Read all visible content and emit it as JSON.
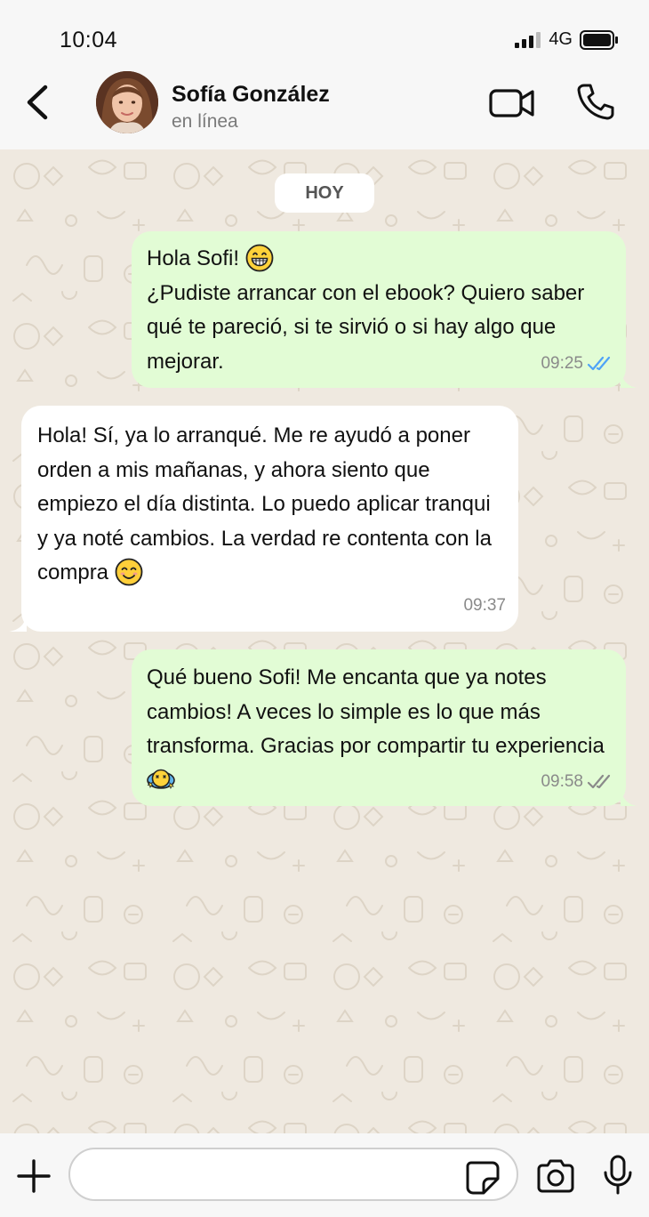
{
  "status_bar": {
    "time": "10:04",
    "network": "4G"
  },
  "header": {
    "contact_name": "Sofía González",
    "contact_status": "en línea"
  },
  "chat": {
    "date_label": "HOY",
    "messages": [
      {
        "direction": "out",
        "line1": "Hola Sofi! ",
        "text": "¿Pudiste arrancar con el ebook? Quiero saber qué te pareció, si te sirvió o si hay algo que mejorar.",
        "emoji": "grinning-face-emoji",
        "time": "09:25",
        "ticks": "read"
      },
      {
        "direction": "in",
        "text": "Hola! Sí, ya lo arranqué. Me re ayudó a poner orden a mis mañanas, y ahora siento que empiezo el día distinta. Lo puedo aplicar tranqui y ya noté cambios. La verdad re contenta con la compra ",
        "emoji": "smiling-face-emoji",
        "time": "09:37"
      },
      {
        "direction": "out",
        "text": "Qué bueno Sofi! Me encanta que ya notes cambios! A veces lo simple es lo que más transforma. Gracias por compartir tu experiencia ",
        "emoji": "dizzy-face-emoji",
        "time": "09:58",
        "ticks": "delivered"
      }
    ]
  },
  "composer": {
    "placeholder": ""
  },
  "colors": {
    "outgoing_bubble": "#e2fcd5",
    "incoming_bubble": "#ffffff",
    "read_ticks": "#4fa3f7",
    "delivered_ticks": "#8a8a8a"
  }
}
